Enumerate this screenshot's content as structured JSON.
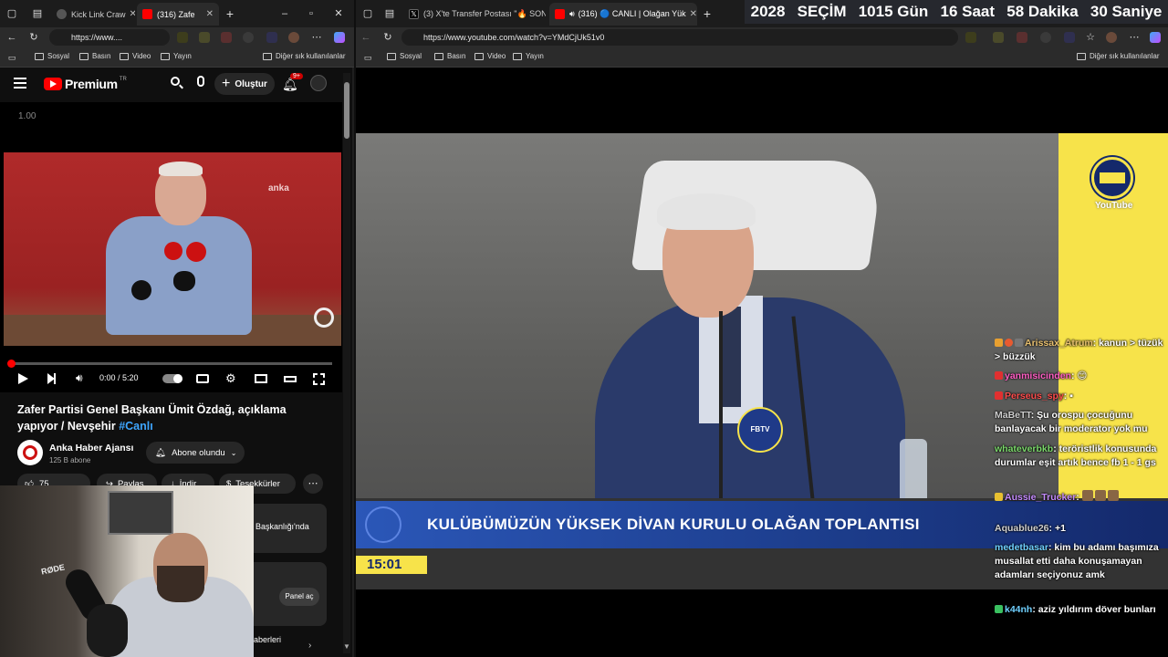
{
  "left_browser": {
    "tabs": [
      {
        "label": "Kick Link Craw",
        "active": false
      },
      {
        "label": "(316) Zafe",
        "active": true
      }
    ],
    "url": "https://www....",
    "bookmarks": [
      "Sosyal",
      "Basın",
      "Video",
      "Yayın"
    ],
    "other_bookmarks": "Diğer sık kullanılanlar"
  },
  "youtube": {
    "logo": "Premium",
    "logo_suffix": "TR",
    "create_label": "Oluştur",
    "notif_count": "9+",
    "speed_label": "1.00",
    "video_watermark": "anka",
    "time": "0:00 / 5:20",
    "title": "Zafer Partisi Genel Başkanı Ümit Özdağ, açıklama yapıyor / Nevşehir",
    "hashtag": "#Canlı",
    "channel": "Anka Haber Ajansı",
    "subs": "125 B abone",
    "subscribed_label": "Abone olundu",
    "likes": "75",
    "share_label": "Paylaş",
    "download_label": "İndir",
    "thanks_label": "Teşekkürler",
    "related_1": "Başkanlığı'nda",
    "panel_label": "Panel aç",
    "related_2": "aberleri",
    "mic_brand": "RØDE"
  },
  "right_browser": {
    "tabs": [
      {
        "label": "(3) X'te Transfer Postası \"🔥 SON",
        "active": false
      },
      {
        "label": "(316) 🔵 CANLI | Olağan Yük",
        "active": true
      }
    ],
    "url": "https://www.youtube.com/watch?v=YMdCjUk51v0",
    "bookmarks": [
      "Sosyal",
      "Basın",
      "Video",
      "Yayın"
    ],
    "other_bookmarks": "Diğer sık kullanılanlar"
  },
  "countdown": {
    "items": [
      "2028",
      "SEÇİM",
      "1015 Gün",
      "16 Saat",
      "58 Dakika",
      "30 Saniye"
    ]
  },
  "stream": {
    "lower_third": "KULÜBÜMÜZÜN YÜKSEK DİVAN KURULU OLAĞAN TOPLANTISI",
    "clock": "15:01",
    "logo_text": "YouTube",
    "mic_label": "FBTV"
  },
  "chat": [
    {
      "user": "Arissax_Atrum",
      "color": "#e8c070",
      "msg": "kanun > tüzük > büzzük"
    },
    {
      "user": "yanmisicinden",
      "color": "#ff5ec4",
      "msg": "😊"
    },
    {
      "user": "Perseus_spy",
      "color": "#ff4d4d",
      "msg": "▪"
    },
    {
      "user": "MaBeTT",
      "color": "#cfcfcf",
      "msg": "Şu orospu çocuğunu banlayacak bir moderator yok mu"
    },
    {
      "user": "whateverbkb",
      "color": "#7bd96b",
      "msg": "teröristlik konusunda durumlar eşit artık bence fb 1 - 1 gs"
    },
    {
      "user": "Aussie_Trucker",
      "color": "#c58cff",
      "msg": ""
    },
    {
      "user": "Aquablue26",
      "color": "#cfcfcf",
      "msg": "+1"
    },
    {
      "user": "medetbasar",
      "color": "#6fd0ff",
      "msg": "kim bu adamı başımıza musallat etti daha konuşamayan adamları seçiyonuz amk"
    },
    {
      "user": "k44nh",
      "color": "#6fd0ff",
      "msg": "aziz yıldırım döver bunları"
    }
  ],
  "colors": {
    "yt_red": "#ff0000",
    "fb_yellow": "#f7e34a",
    "fb_navy": "#14296b",
    "lower_third_blue": "#1c3c8a"
  }
}
